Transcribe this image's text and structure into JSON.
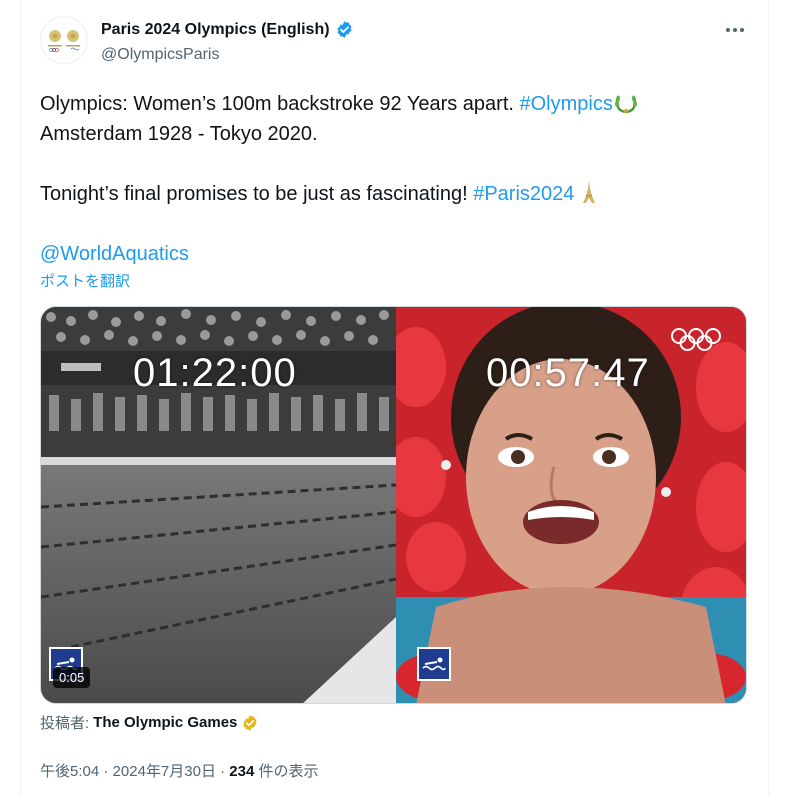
{
  "author": {
    "display_name": "Paris 2024 Olympics (English)",
    "handle": "@OlympicsParis",
    "verified": true,
    "verified_color": "#1d9bf0"
  },
  "tweet": {
    "line1_text": "Olympics: Women’s 100m backstroke 92 Years apart. ",
    "line1_hashtag": "#Olympics",
    "line1_emoji": "laurel-wreath-icon",
    "line2_text": "Amsterdam 1928 - Tokyo 2020.",
    "line4_text": "Tonight’s final promises to be just as fascinating! ",
    "line4_hashtag": "#Paris2024",
    "line4_emoji": "eiffel-tower-icon",
    "mention": "@WorldAquatics",
    "translate_label": "ポストを翻訳"
  },
  "media": {
    "left_timer": "01:22:00",
    "right_timer": "00:57:47",
    "duration": "0:05",
    "left_scene": "black-and-white 1928 pool with crowd",
    "right_scene": "swimmer smiling in pool with red lane ropes"
  },
  "posted_by": {
    "prefix": "投稿者: ",
    "name": "The Olympic Games",
    "badge_color": "#e2b719"
  },
  "meta": {
    "time": "午後5:04",
    "separator": " · ",
    "date": "2024年7月30日",
    "views_count": "234",
    "views_label": " 件の表示"
  },
  "colors": {
    "link": "#1d9bf0",
    "text": "#0f1419",
    "secondary": "#536471"
  }
}
